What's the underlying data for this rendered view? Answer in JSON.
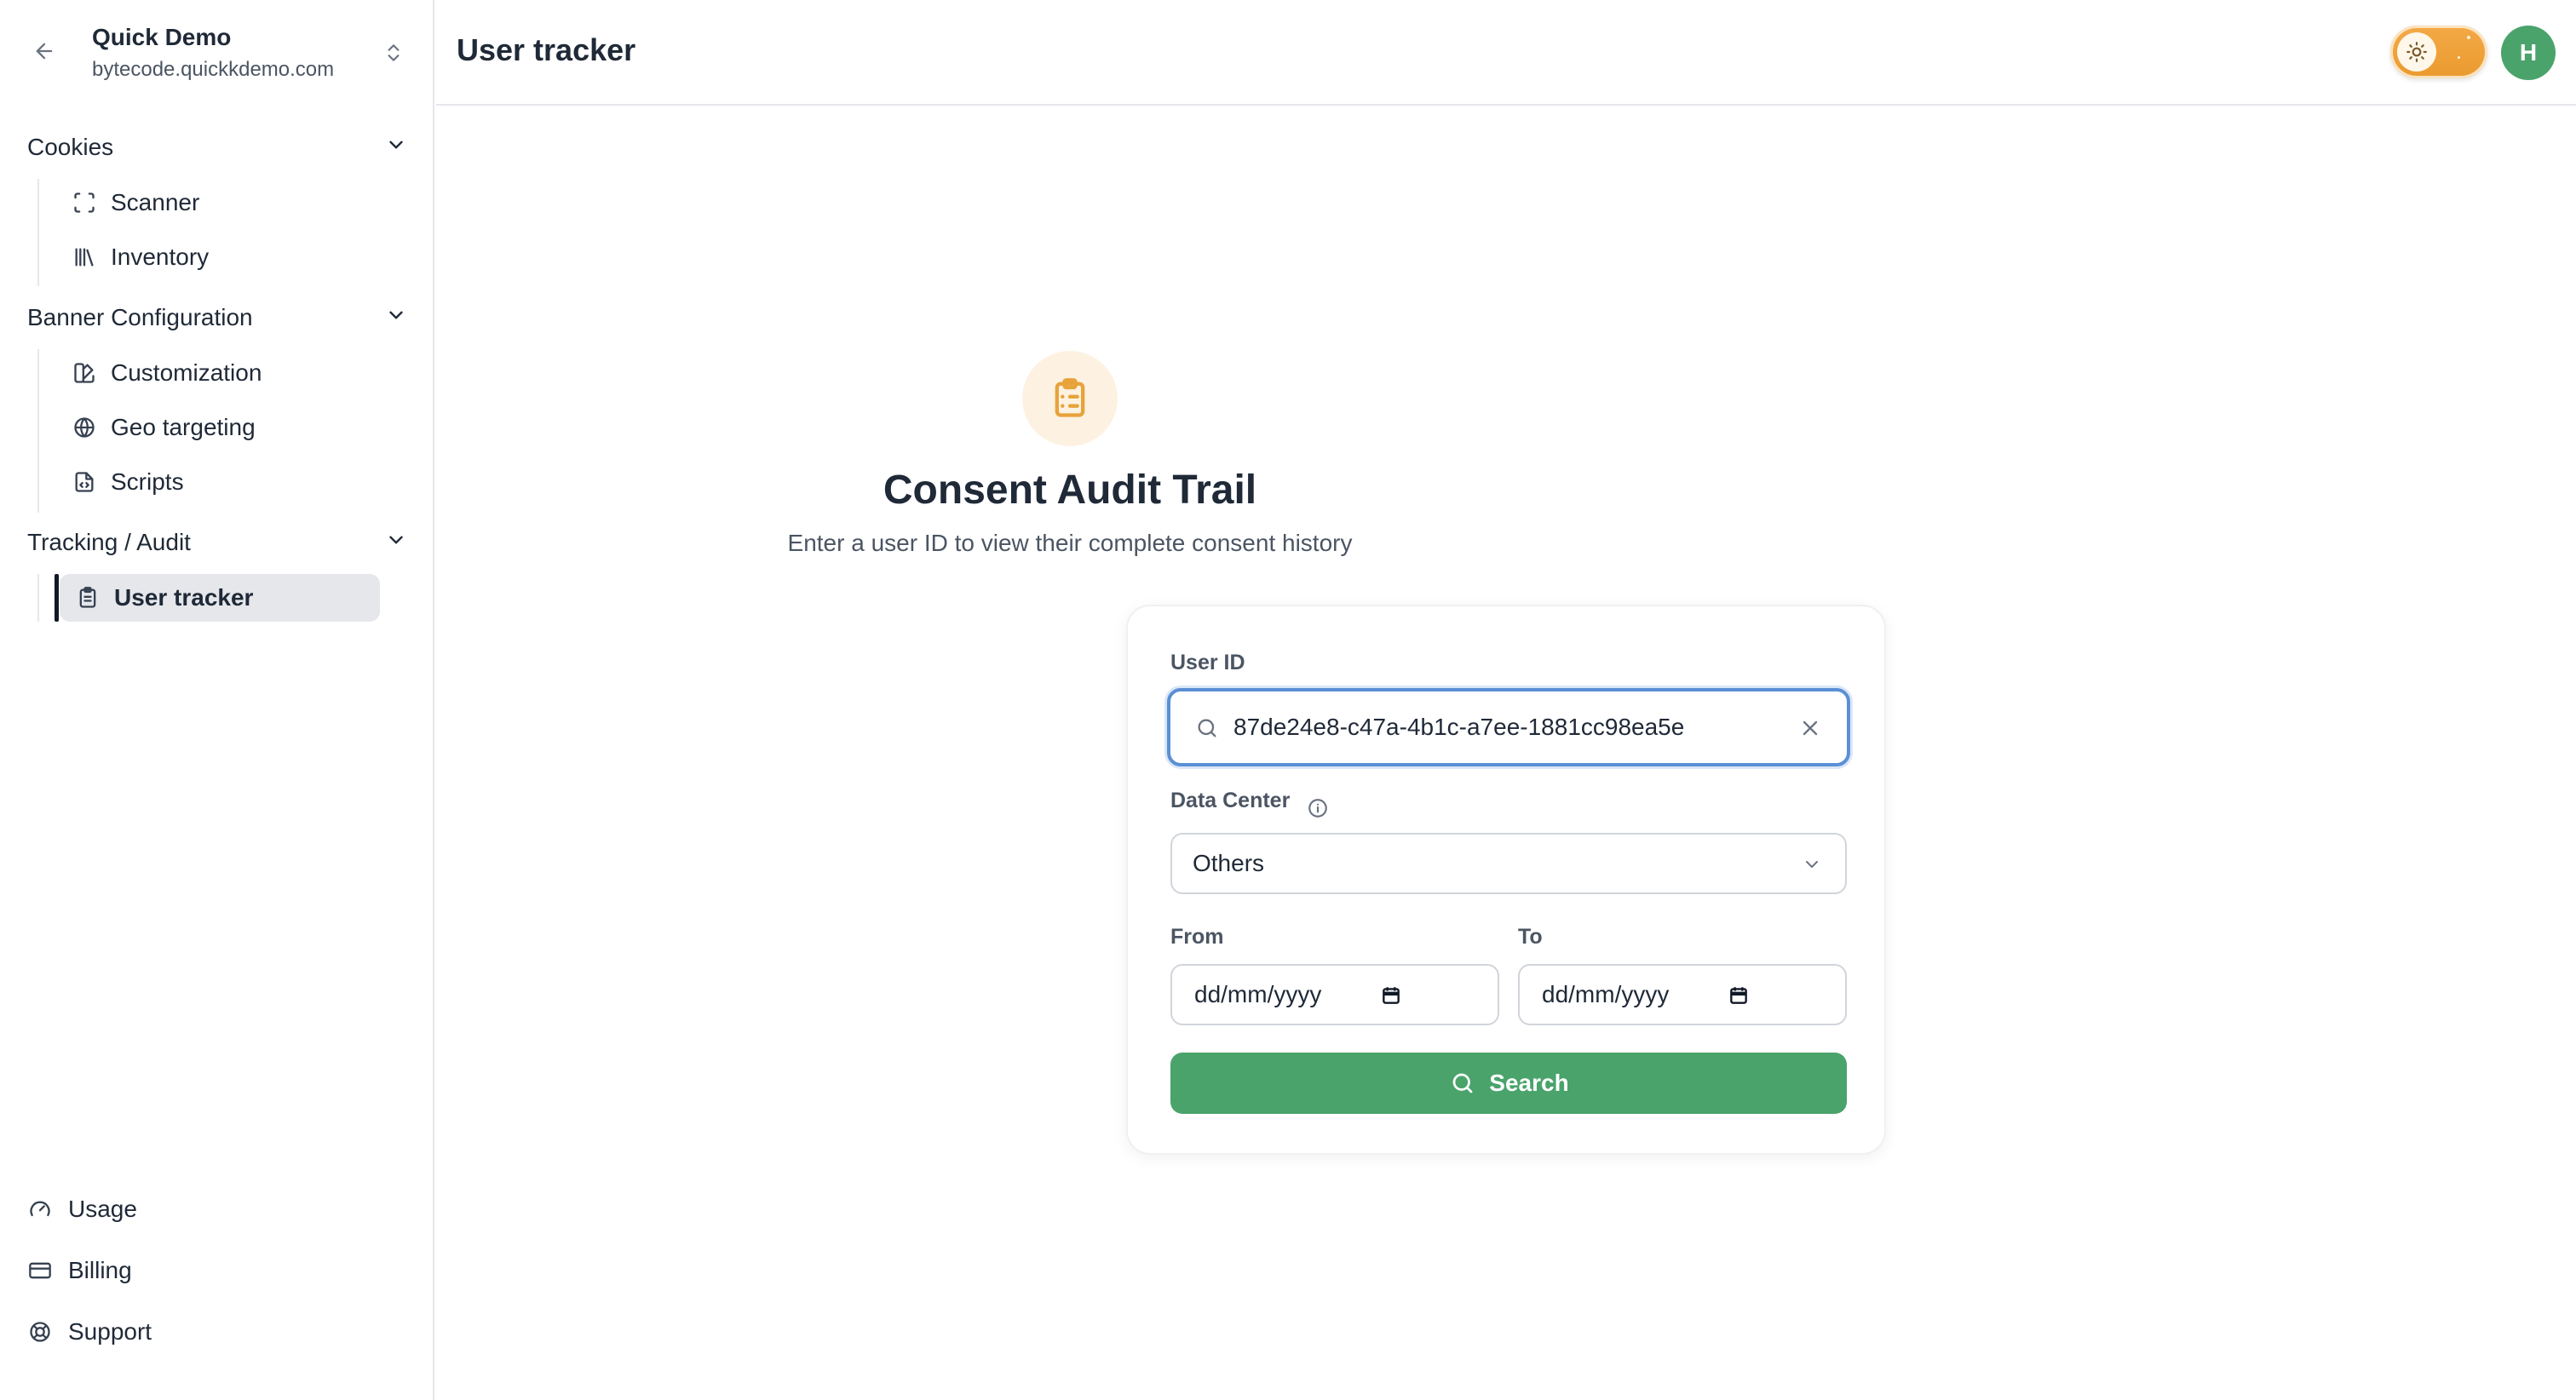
{
  "sidebar": {
    "org_name": "Quick Demo",
    "org_domain": "bytecode.quickkdemo.com",
    "groups": [
      {
        "label": "Cookies",
        "items": [
          {
            "label": "Scanner",
            "icon": "scan-icon"
          },
          {
            "label": "Inventory",
            "icon": "library-icon"
          }
        ]
      },
      {
        "label": "Banner Configuration",
        "items": [
          {
            "label": "Customization",
            "icon": "palette-icon"
          },
          {
            "label": "Geo targeting",
            "icon": "globe-icon"
          },
          {
            "label": "Scripts",
            "icon": "file-code-icon"
          }
        ]
      },
      {
        "label": "Tracking / Audit",
        "items": [
          {
            "label": "User tracker",
            "icon": "clipboard-icon",
            "active": true
          }
        ]
      }
    ],
    "bottom": [
      {
        "label": "Usage",
        "icon": "gauge-icon"
      },
      {
        "label": "Billing",
        "icon": "credit-card-icon"
      },
      {
        "label": "Support",
        "icon": "life-buoy-icon"
      }
    ]
  },
  "header": {
    "title": "User tracker",
    "avatar_initial": "H",
    "theme": "light"
  },
  "main": {
    "heading": "Consent Audit Trail",
    "subheading": "Enter a user ID to view their complete consent history",
    "form": {
      "user_id_label": "User ID",
      "user_id_value": "87de24e8-c47a-4b1c-a7ee-1881cc98ea5e",
      "data_center_label": "Data Center",
      "data_center_value": "Others",
      "from_label": "From",
      "from_placeholder": "dd/mm/yyyy",
      "to_label": "To",
      "to_placeholder": "dd/mm/yyyy",
      "search_label": "Search"
    }
  },
  "colors": {
    "accent_green": "#4aa36b",
    "focus_blue": "#5b8fd6",
    "toggle_orange": "#ea9a2e",
    "hero_icon": "#e8a33b"
  }
}
